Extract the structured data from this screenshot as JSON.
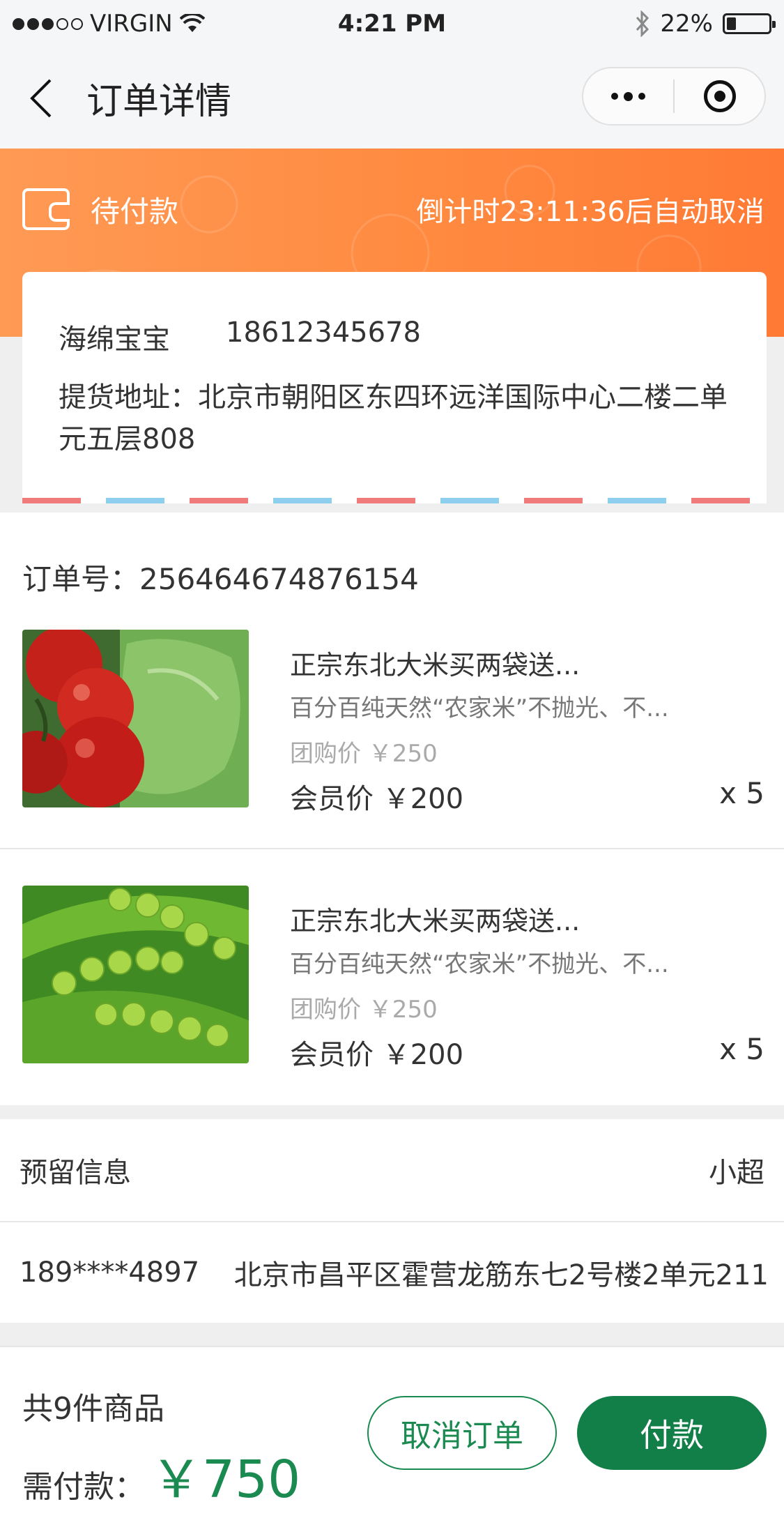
{
  "status_bar": {
    "carrier": "VIRGIN",
    "time": "4:21 PM",
    "battery": "22%",
    "battery_level": 0.22,
    "icons": [
      "signal-dots",
      "wifi-icon",
      "bluetooth-icon",
      "battery-icon"
    ]
  },
  "nav": {
    "title": "订单详情",
    "icons": [
      "back-chevron-icon",
      "more-dots-icon",
      "target-icon"
    ]
  },
  "banner": {
    "status": "待付款",
    "countdown": "倒计时23:11:36后自动取消",
    "icon": "wallet-icon"
  },
  "address": {
    "name": "海绵宝宝",
    "phone": "18612345678",
    "pickup": "提货地址：北京市朝阳区东四环远洋国际中心二楼二单元五层808"
  },
  "order": {
    "order_no": "订单号：256464674876154",
    "items": [
      {
        "name": "正宗东北大米买两袋送...",
        "desc": "百分百纯天然“农家米”不抛光、不...",
        "group_price": "团购价 ￥250",
        "member_price": "会员价 ￥200",
        "qty": "x 5",
        "image": "tomatoes-and-lettuce-photo"
      },
      {
        "name": "正宗东北大米买两袋送...",
        "desc": "百分百纯天然“农家米”不抛光、不...",
        "group_price": "团购价 ￥250",
        "member_price": "会员价 ￥200",
        "qty": "x 5",
        "image": "green-peas-photo"
      }
    ]
  },
  "reserve": {
    "label": "预留信息",
    "name": "小超",
    "phone": "189****4897",
    "address": "北京市昌平区霍营龙筋东七2号楼2单元211"
  },
  "footer": {
    "total_count": "共9件商品",
    "pay_label": "需付款：",
    "pay_amount": "￥750",
    "cancel_label": "取消订单",
    "pay_label_btn": "付款"
  },
  "colors": {
    "banner_orange": "#ff8a40",
    "accent_green": "#137f48",
    "stripe_red": "#f07b7b",
    "stripe_blue": "#8ecff0"
  }
}
